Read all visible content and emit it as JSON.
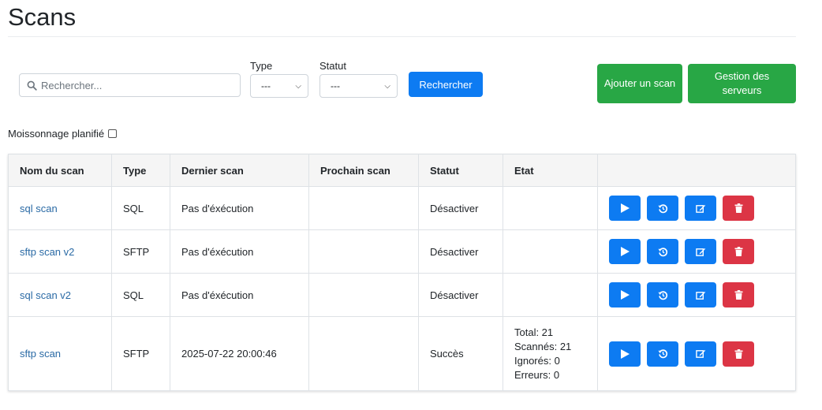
{
  "page": {
    "title": "Scans"
  },
  "search": {
    "placeholder": "Rechercher...",
    "value": ""
  },
  "filters": {
    "type_label": "Type",
    "type_value": "---",
    "status_label": "Statut",
    "status_value": "---",
    "search_button": "Rechercher"
  },
  "buttons": {
    "add_scan": "Ajouter un scan",
    "manage_servers": "Gestion des serveurs"
  },
  "planned": {
    "label": "Moissonnage planifié",
    "checked": false
  },
  "table": {
    "headers": [
      "Nom du scan",
      "Type",
      "Dernier scan",
      "Prochain scan",
      "Statut",
      "Etat",
      ""
    ],
    "rows": [
      {
        "name": "sql scan",
        "type": "SQL",
        "last": "Pas d'éxécution",
        "next": "",
        "status": "Désactiver",
        "etat": []
      },
      {
        "name": "sftp scan v2",
        "type": "SFTP",
        "last": "Pas d'éxécution",
        "next": "",
        "status": "Désactiver",
        "etat": []
      },
      {
        "name": "sql scan v2",
        "type": "SQL",
        "last": "Pas d'éxécution",
        "next": "",
        "status": "Désactiver",
        "etat": []
      },
      {
        "name": "sftp scan",
        "type": "SFTP",
        "last": "2025-07-22 20:00:46",
        "next": "",
        "status": "Succès",
        "etat": [
          "Total: 21",
          "Scannés: 21",
          "Ignorés: 0",
          "Erreurs: 0"
        ]
      }
    ]
  },
  "actions": [
    {
      "icon": "play-icon",
      "color": "#0d7bf2"
    },
    {
      "icon": "history-icon",
      "color": "#0d7bf2"
    },
    {
      "icon": "edit-icon",
      "color": "#0d7bf2"
    },
    {
      "icon": "trash-icon",
      "color": "#dc3545"
    }
  ],
  "colors": {
    "primary": "#0d7bf2",
    "success": "#28a745",
    "danger": "#dc3545",
    "link": "#2a6aa5"
  }
}
